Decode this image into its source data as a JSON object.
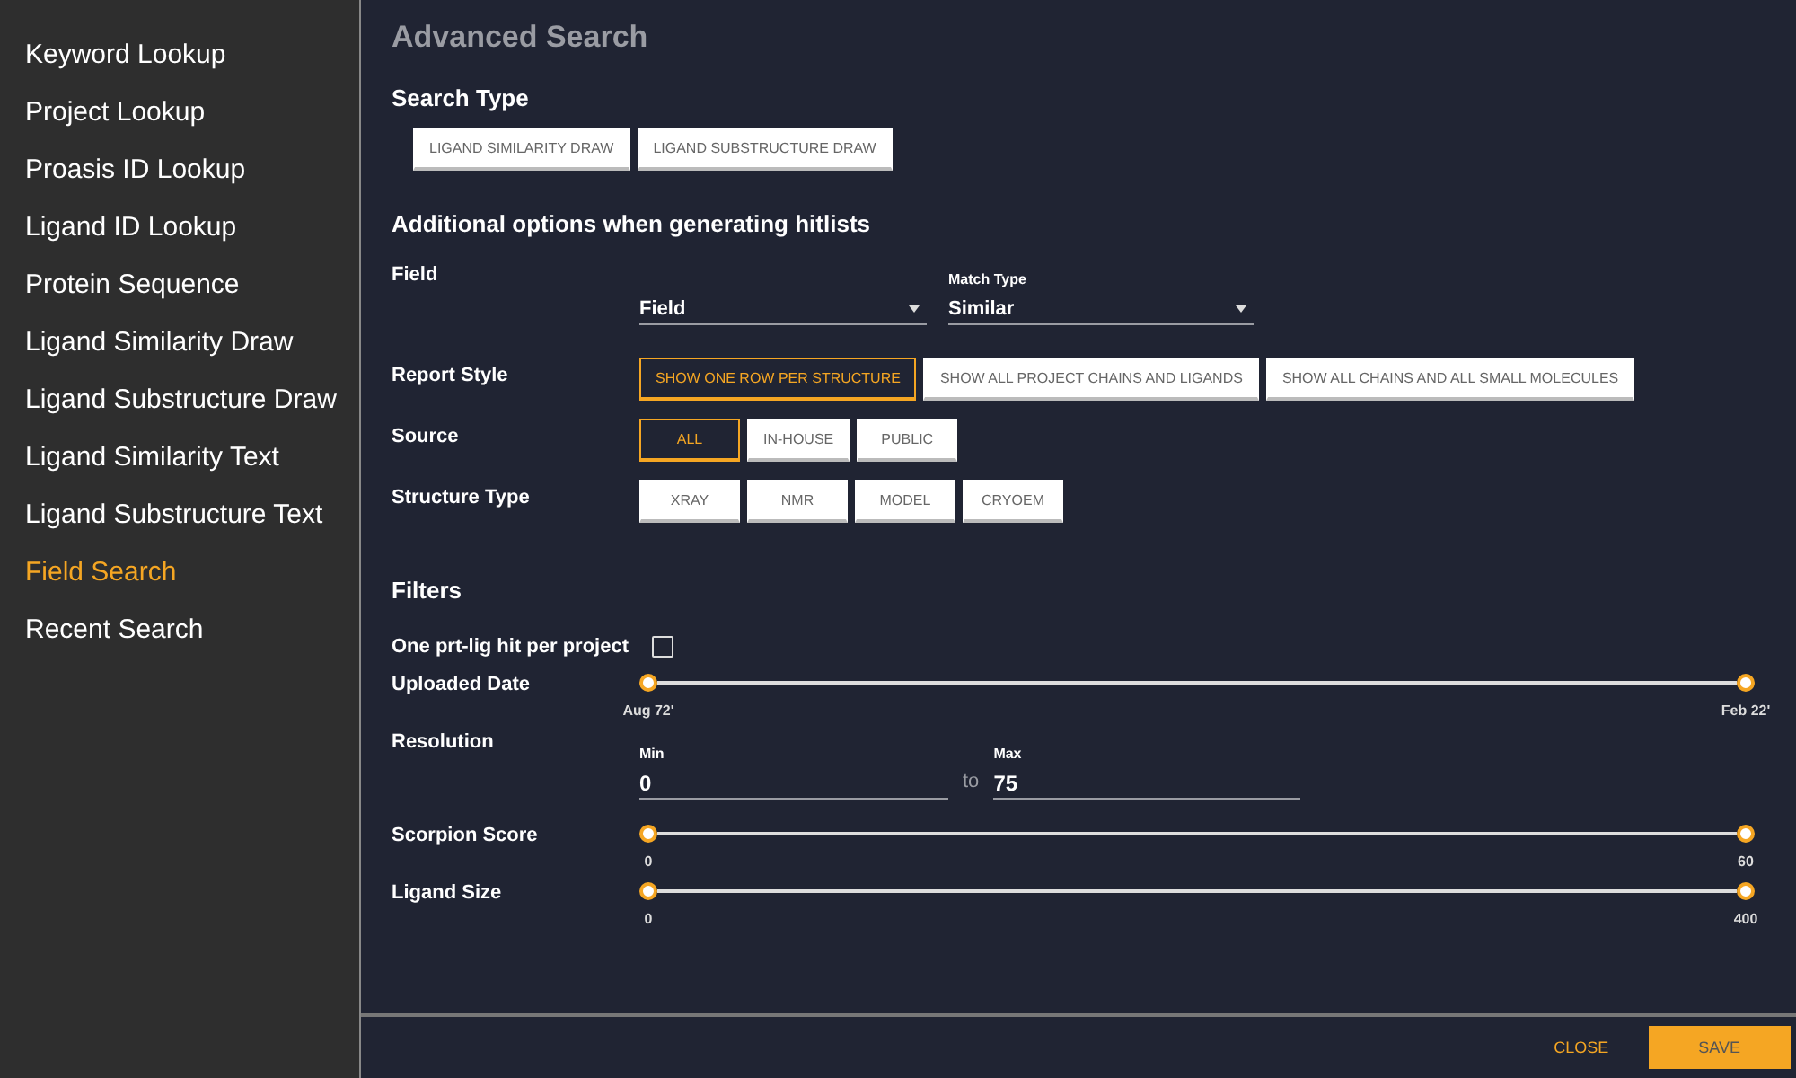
{
  "sidebar": {
    "items": [
      {
        "label": "Keyword Lookup",
        "selected": false
      },
      {
        "label": "Project Lookup",
        "selected": false
      },
      {
        "label": "Proasis ID Lookup",
        "selected": false
      },
      {
        "label": "Ligand ID Lookup",
        "selected": false
      },
      {
        "label": "Protein Sequence",
        "selected": false
      },
      {
        "label": "Ligand Similarity Draw",
        "selected": false
      },
      {
        "label": "Ligand Substructure Draw",
        "selected": false
      },
      {
        "label": "Ligand Similarity Text",
        "selected": false
      },
      {
        "label": "Ligand Substructure Text",
        "selected": false
      },
      {
        "label": "Field Search",
        "selected": true
      },
      {
        "label": "Recent Search",
        "selected": false
      }
    ]
  },
  "title": "Advanced Search",
  "search_type": {
    "heading": "Search Type",
    "options": [
      {
        "label": "LIGAND SIMILARITY DRAW",
        "selected": false
      },
      {
        "label": "LIGAND SUBSTRUCTURE DRAW",
        "selected": false
      }
    ]
  },
  "additional": {
    "heading": "Additional options when generating hitlists",
    "field": {
      "label": "Field",
      "select": {
        "value": "Field"
      },
      "match_type": {
        "label": "Match Type",
        "value": "Similar"
      }
    },
    "groups": [
      {
        "label": "Report Style",
        "options": [
          {
            "label": "SHOW ONE ROW PER STRUCTURE",
            "selected": true
          },
          {
            "label": "SHOW ALL PROJECT CHAINS AND LIGANDS",
            "selected": false
          },
          {
            "label": "SHOW ALL CHAINS AND ALL SMALL MOLECULES",
            "selected": false
          }
        ]
      },
      {
        "label": "Source",
        "options": [
          {
            "label": "ALL",
            "selected": true
          },
          {
            "label": "IN-HOUSE",
            "selected": false
          },
          {
            "label": "PUBLIC",
            "selected": false
          }
        ]
      },
      {
        "label": "Structure Type",
        "options": [
          {
            "label": "XRAY",
            "selected": false
          },
          {
            "label": "NMR",
            "selected": false
          },
          {
            "label": "MODEL",
            "selected": false
          },
          {
            "label": "CRYOEM",
            "selected": false
          }
        ]
      }
    ]
  },
  "filters": {
    "heading": "Filters",
    "items": [
      {
        "kind": "checkbox",
        "label": "One prt-lig hit per project",
        "checked": false
      },
      {
        "kind": "range",
        "label": "Uploaded Date",
        "thumbs": [
          {
            "level": 0,
            "reading": "Aug 72'"
          },
          {
            "level": 1,
            "reading": "Feb 22'"
          }
        ]
      },
      {
        "kind": "minmax",
        "label": "Resolution",
        "min": {
          "label": "Min",
          "value": "0"
        },
        "separator": "to",
        "max": {
          "label": "Max",
          "value": "75"
        }
      },
      {
        "kind": "range",
        "label": "Scorpion Score",
        "thumbs": [
          {
            "level": 0,
            "reading": "0"
          },
          {
            "level": 1,
            "reading": "60"
          }
        ]
      },
      {
        "kind": "range",
        "label": "Ligand Size",
        "thumbs": [
          {
            "level": 0,
            "reading": "0"
          },
          {
            "level": 1,
            "reading": "400"
          }
        ]
      }
    ]
  },
  "footer": {
    "buttons": [
      {
        "label": "CLOSE",
        "kind": "text"
      },
      {
        "label": "SAVE",
        "kind": "primary"
      }
    ]
  }
}
